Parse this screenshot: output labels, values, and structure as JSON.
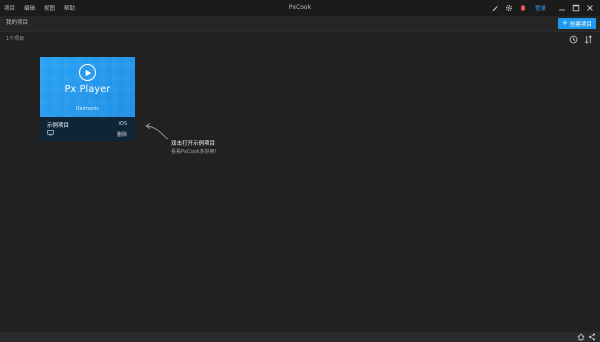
{
  "menu": [
    "项目",
    "编辑",
    "视图",
    "帮助"
  ],
  "app_title": "PxCook",
  "titlebar_icons": [
    "pen-icon",
    "gear-icon",
    "bell-icon"
  ],
  "login_label": "登录",
  "subheader": {
    "label": "我的项目",
    "create_button": "创建项目"
  },
  "toolbar": {
    "count": "1个项目"
  },
  "card": {
    "app_name": "Px Player",
    "subtitle": "Ueimonic",
    "project_name": "示例项目",
    "platform": "iOS",
    "delete_label": "删除",
    "accent": "#2aa2f5"
  },
  "hint": {
    "title": "双击打开示例项目",
    "subtitle": "看看PxCook多好用!"
  }
}
